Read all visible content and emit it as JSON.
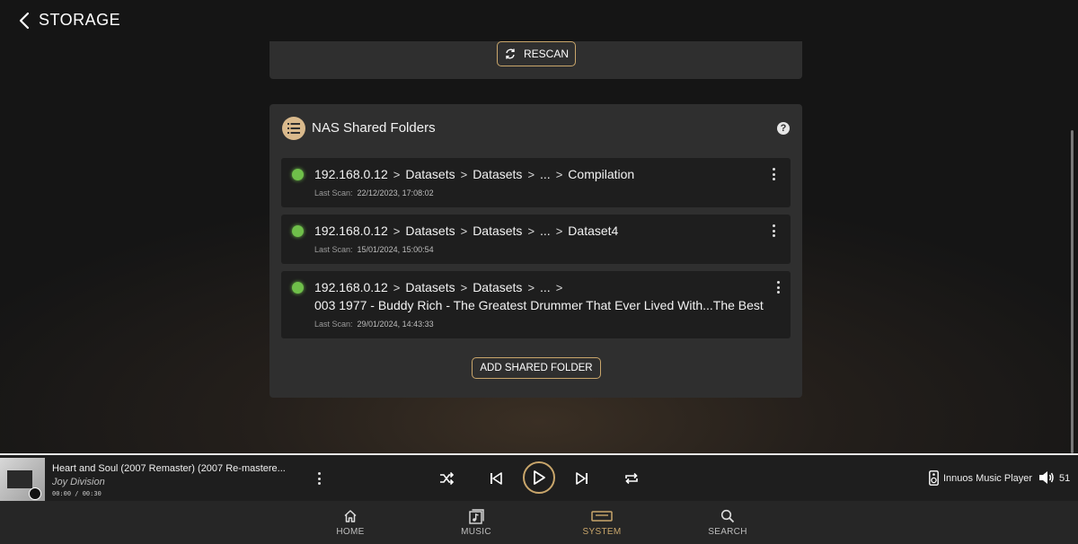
{
  "header": {
    "title": "STORAGE"
  },
  "rescan": {
    "label": "RESCAN"
  },
  "nas": {
    "title": "NAS Shared Folders",
    "folders": [
      {
        "path": [
          "192.168.0.12",
          "Datasets",
          "Datasets",
          "...",
          "Compilation"
        ],
        "path_line2": "",
        "last_scan_label": "Last Scan:",
        "last_scan": "22/12/2023, 17:08:02"
      },
      {
        "path": [
          "192.168.0.12",
          "Datasets",
          "Datasets",
          "...",
          "Dataset4"
        ],
        "path_line2": "",
        "last_scan_label": "Last Scan:",
        "last_scan": "15/01/2024, 15:00:54"
      },
      {
        "path": [
          "192.168.0.12",
          "Datasets",
          "Datasets",
          "...",
          ""
        ],
        "path_line2": "003 1977 - Buddy Rich - The Greatest Drummer That Ever Lived With...The Best",
        "last_scan_label": "Last Scan:",
        "last_scan": "29/01/2024, 14:43:33"
      }
    ],
    "add_label": "ADD SHARED FOLDER"
  },
  "player": {
    "track_title": "Heart and Soul (2007 Remaster) (2007 Re-mastere...",
    "artist": "Joy Division",
    "time": "00:00 / 00:30",
    "output_name": "Innuos Music Player",
    "volume": "51"
  },
  "nav": {
    "items": [
      {
        "label": "HOME",
        "icon": "home-icon"
      },
      {
        "label": "MUSIC",
        "icon": "music-library-icon"
      },
      {
        "label": "SYSTEM",
        "icon": "system-icon",
        "active": true
      },
      {
        "label": "SEARCH",
        "icon": "search-icon"
      }
    ]
  },
  "colors": {
    "accent": "#c9a66b",
    "status_ok": "#6fbf4a",
    "card": "#2f2f2f",
    "row": "#1e1e1e"
  }
}
